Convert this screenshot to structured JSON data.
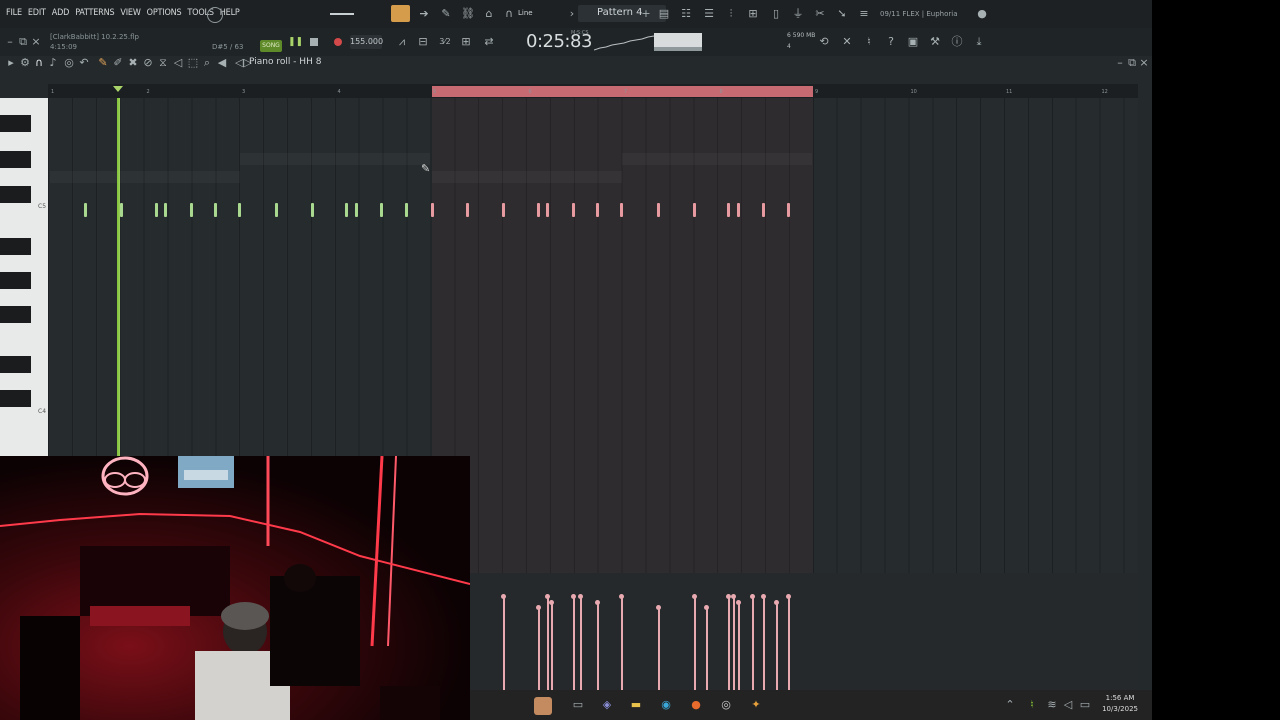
{
  "menu": [
    "FILE",
    "EDIT",
    "ADD",
    "PATTERNS",
    "VIEW",
    "OPTIONS",
    "TOOLS",
    "HELP"
  ],
  "toolbar": {
    "snap_mode": "Line",
    "pattern": "Pattern 4",
    "hint_text": "09/11 FLEX | Euphoria"
  },
  "transport": {
    "file_name": "[ClarkBabbitt] 10.2.25.flp",
    "file_time": "4:15:09",
    "note_readout": "D#5 / 63",
    "song_label": "SONG",
    "tempo": "155.000",
    "time": "0:25:83",
    "mcs_label": "M:S:CS",
    "cpu": "6",
    "memory": "590 MB",
    "poly": "4"
  },
  "piano_roll": {
    "title": "Piano roll - HH 8",
    "bar_numbers": [
      "1",
      "2",
      "3",
      "4",
      "5",
      "6",
      "7",
      "8",
      "9",
      "10",
      "11",
      "12"
    ],
    "key_labels": [
      "C5",
      "C4"
    ],
    "loop_region_bars": [
      5,
      9
    ],
    "playhead_bar": 1.7,
    "notes_green_bars": [
      1.37,
      1.74,
      2.11,
      2.2,
      2.48,
      2.73,
      2.98,
      3.37,
      3.74,
      4.1,
      4.2,
      4.47,
      4.73
    ],
    "notes_red_bars": [
      5.0,
      5.37,
      5.74,
      6.11,
      6.2,
      6.48,
      6.73,
      6.98,
      7.37,
      7.74,
      8.1,
      8.2,
      8.47,
      8.73
    ],
    "velocities": [
      0.85,
      0.75,
      0.85,
      0.8,
      0.85,
      0.85,
      0.8,
      0.85,
      0.75,
      0.85,
      0.75,
      0.85,
      0.85,
      0.8,
      0.85,
      0.85,
      0.8,
      0.85
    ]
  },
  "taskbar": {
    "time": "1:56 AM",
    "date": "10/3/2025"
  },
  "colors": {
    "note_green": "#a9d88f",
    "note_red": "#e79aa0",
    "loop_region": "#c76a72",
    "playhead": "#8fca48"
  }
}
